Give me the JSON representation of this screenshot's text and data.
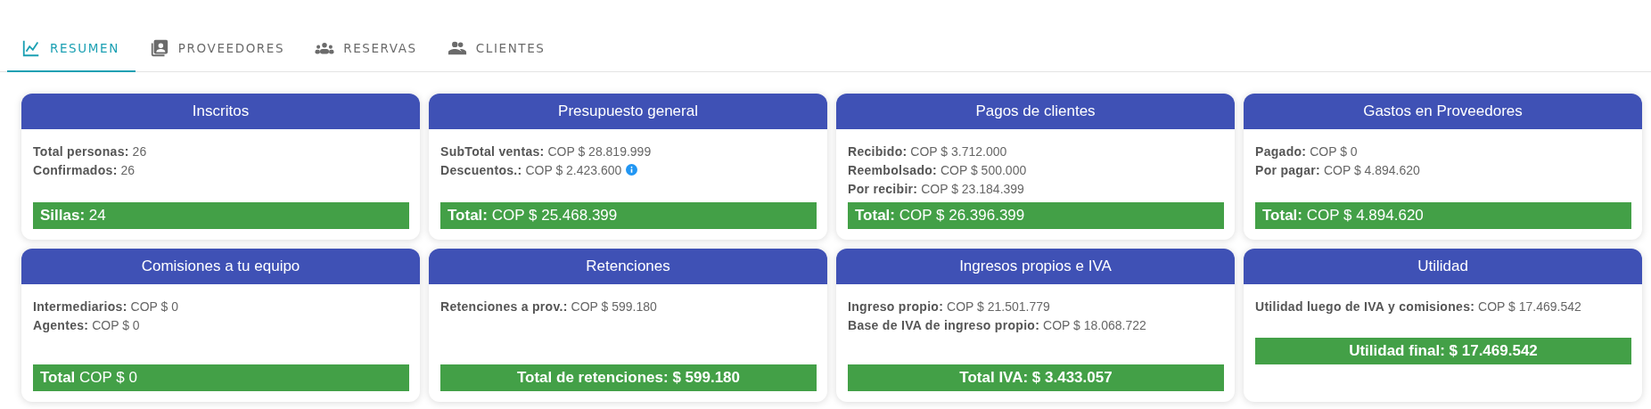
{
  "tabs": [
    {
      "label": "RESUMEN",
      "selected": true
    },
    {
      "label": "PROVEEDORES",
      "selected": false
    },
    {
      "label": "RESERVAS",
      "selected": false
    },
    {
      "label": "CLIENTES",
      "selected": false
    }
  ],
  "cards": [
    {
      "title": "Inscritos",
      "lines": [
        {
          "label": "Total personas:",
          "value": "26"
        },
        {
          "label": "Confirmados:",
          "value": "26"
        }
      ],
      "total": {
        "kind": "split",
        "label": "Sillas:",
        "value": "24"
      }
    },
    {
      "title": "Presupuesto general",
      "lines": [
        {
          "label": "SubTotal ventas:",
          "value": "COP $ 28.819.999"
        },
        {
          "label": "Descuentos.:",
          "value": "COP $ 2.423.600",
          "info": true
        }
      ],
      "total": {
        "kind": "split",
        "label": "Total:",
        "value": "COP $ 25.468.399"
      }
    },
    {
      "title": "Pagos de clientes",
      "lines": [
        {
          "label": "Recibido:",
          "value": "COP $ 3.712.000"
        },
        {
          "label": "Reembolsado:",
          "value": "COP $ 500.000"
        },
        {
          "label": "Por recibir:",
          "value": "COP $ 23.184.399"
        }
      ],
      "total": {
        "kind": "split",
        "label": "Total:",
        "value": "COP $ 26.396.399"
      }
    },
    {
      "title": "Gastos en Proveedores",
      "lines": [
        {
          "label": "Pagado:",
          "value": "COP $ 0"
        },
        {
          "label": "Por pagar:",
          "value": "COP $ 4.894.620"
        }
      ],
      "total": {
        "kind": "split",
        "label": "Total:",
        "value": "COP $ 4.894.620"
      }
    },
    {
      "title": "Comisiones a tu equipo",
      "lines": [
        {
          "label": "Intermediarios:",
          "value": "COP $ 0"
        },
        {
          "label": "Agentes:",
          "value": "COP $ 0"
        }
      ],
      "total": {
        "kind": "split",
        "label": "Total",
        "value": "COP $ 0"
      }
    },
    {
      "title": "Retenciones",
      "lines": [
        {
          "label": "Retenciones a prov.:",
          "value": "COP $ 599.180"
        }
      ],
      "total": {
        "kind": "centered",
        "text": "Total de retenciones: $ 599.180"
      }
    },
    {
      "title": "Ingresos propios e IVA",
      "lines": [
        {
          "label": "Ingreso propio:",
          "value": "COP $ 21.501.779"
        },
        {
          "label": "Base de IVA de ingreso propio:",
          "value": "COP $ 18.068.722"
        }
      ],
      "total": {
        "kind": "centered",
        "text": "Total IVA: $ 3.433.057"
      }
    },
    {
      "title": "Utilidad",
      "compact": true,
      "lines": [
        {
          "label": "Utilidad luego de IVA y comisiones:",
          "value": "COP $ 17.469.542"
        }
      ],
      "total": {
        "kind": "centered",
        "text": "Utilidad final: $ 17.469.542"
      }
    }
  ]
}
